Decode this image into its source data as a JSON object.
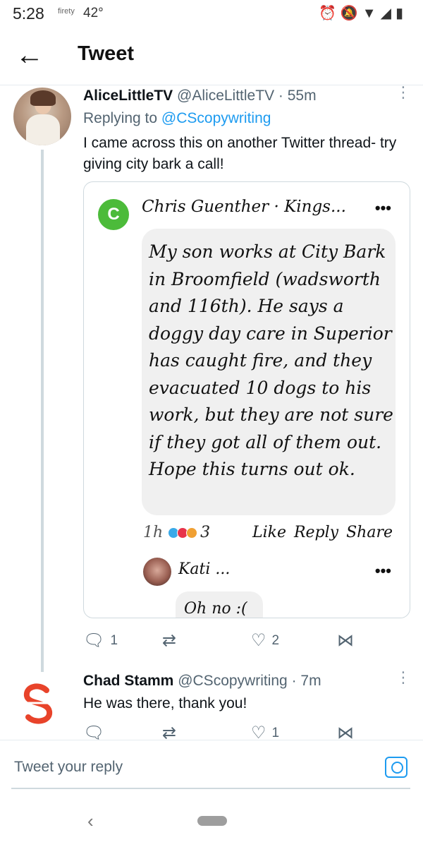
{
  "status_bar": {
    "time": "5:28",
    "brand": "firety",
    "temperature": "42°",
    "icons": [
      "alarm-icon",
      "mute-icon",
      "wifi-icon",
      "signal-icon",
      "battery-icon"
    ]
  },
  "header": {
    "title": "Tweet"
  },
  "tweet1": {
    "name": "AliceLittleTV",
    "handle": "@AliceLittleTV",
    "time": "· 55m",
    "replying_prefix": "Replying to",
    "replying_handle": "@CScopywriting",
    "text": "I came across this on another Twitter thread- try giving city bark a call!",
    "embed": {
      "avatar_letter": "C",
      "poster": "Chris Guenther",
      "group": "· Kings...",
      "comment": "My son works at City Bark in Broomfield (wadsworth and 116th). He says a doggy day care in Superior has caught fire, and they evacuated 10 dogs to his work, but they are not sure if they got all of them out. Hope this turns out ok.",
      "time": "1h",
      "reaction_count": "3",
      "actions": "Like Reply Share",
      "reply_name": "Kati ...",
      "reply_text": "Oh no :("
    },
    "counts": {
      "replies": "1",
      "retweets": "",
      "likes": "2"
    }
  },
  "tweet2": {
    "name": "Chad Stamm",
    "handle": "@CScopywriting",
    "time": "· 7m",
    "text": "He was there, thank you!",
    "counts": {
      "replies": "",
      "retweets": "",
      "likes": "1"
    }
  },
  "reply_box": {
    "placeholder": "Tweet your reply"
  },
  "colors": {
    "accent": "#1d9bf0",
    "muted": "#536471",
    "divider": "#e6ecf0"
  }
}
